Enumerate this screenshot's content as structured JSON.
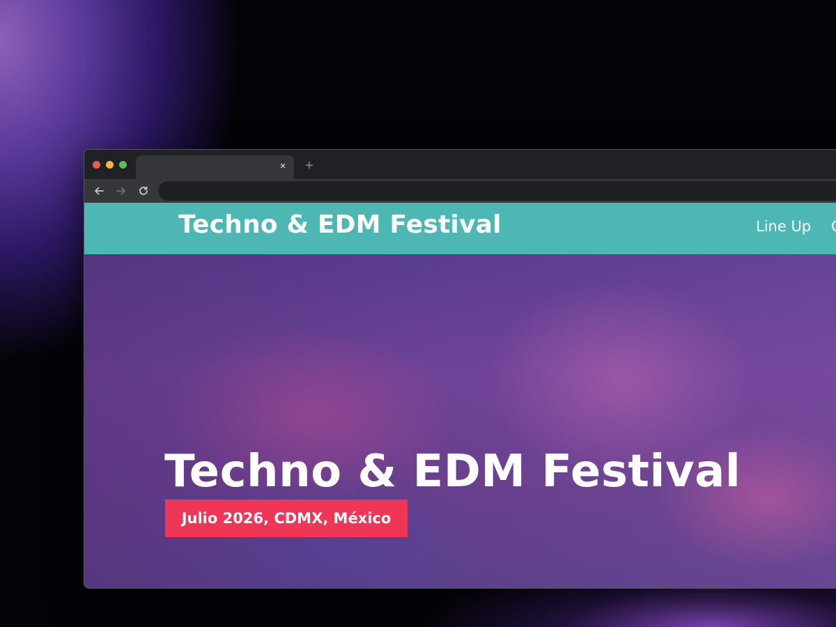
{
  "browser": {
    "tab_close_glyph": "×",
    "new_tab_glyph": "+",
    "url": ""
  },
  "site": {
    "brand": "Techno & EDM Festival",
    "nav": [
      {
        "label": "Line Up"
      },
      {
        "label": "C"
      }
    ]
  },
  "hero": {
    "title": "Techno & EDM Festival",
    "badge": "Julio 2026, CDMX, México"
  },
  "colors": {
    "header_bg": "#4db7b4",
    "badge_bg": "#f03656",
    "browser_chrome": "#202124"
  }
}
